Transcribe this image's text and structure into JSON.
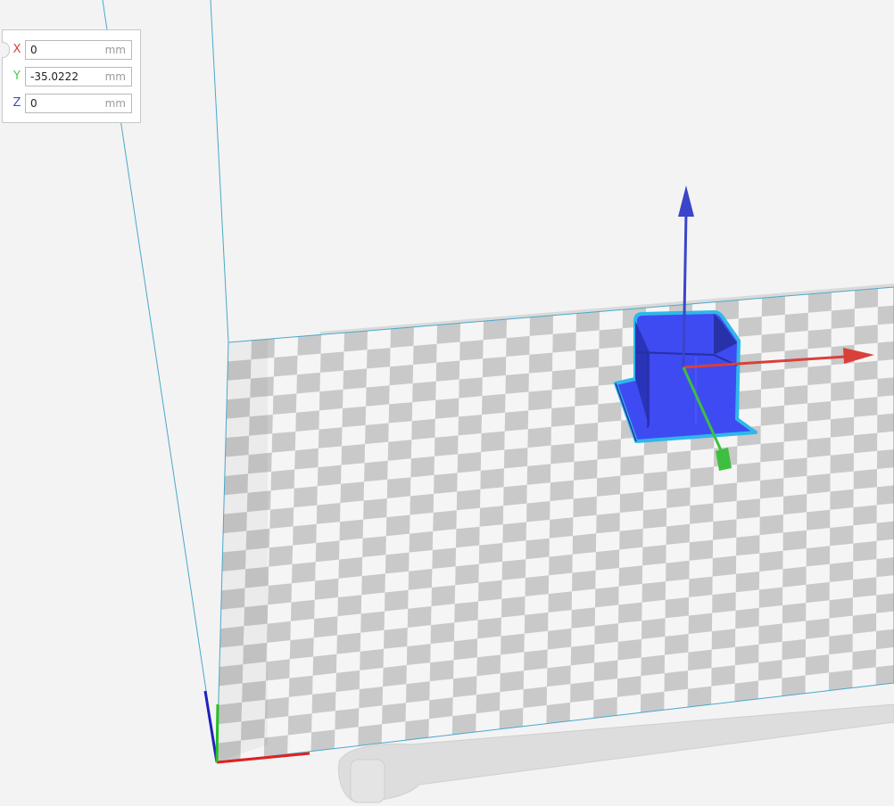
{
  "position_panel": {
    "fields": [
      {
        "axis": "X",
        "value": "0",
        "unit": "mm",
        "color": "#d9403a"
      },
      {
        "axis": "Y",
        "value": "-35.0222",
        "unit": "mm",
        "color": "#4fc94f"
      },
      {
        "axis": "Z",
        "value": "0",
        "unit": "mm",
        "color": "#3a4fb8"
      }
    ]
  },
  "colors": {
    "background": "#f3f3f3",
    "build_volume_outline": "#4aa8c9",
    "checker_light": "#f5f5f5",
    "checker_dark": "#c9c9c9",
    "model_fill": "#3e4bf2",
    "model_outline": "#2fb7ea",
    "gizmo_x": "#d9403a",
    "gizmo_y": "#3fbf3f",
    "gizmo_z": "#3a45c9"
  },
  "icons": {
    "move_x_handle": "arrow-right-icon",
    "move_y_handle": "cube-handle-icon",
    "move_z_handle": "arrow-up-icon"
  }
}
